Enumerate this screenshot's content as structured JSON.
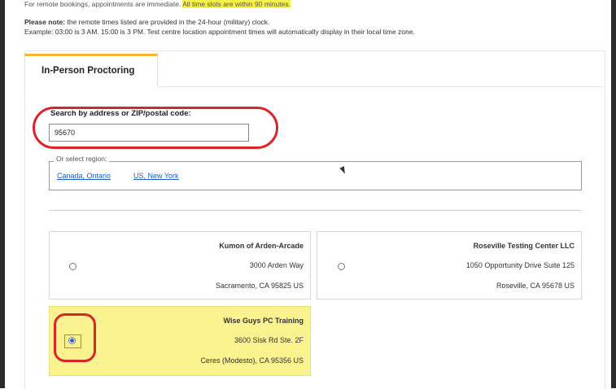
{
  "notes": {
    "top_prefix": "For remote bookings, appointments are immediate.",
    "top_highlight": "All time slots are within 90 minutes.",
    "please_note_bold": "Please note:",
    "please_note_text": "the remote times listed are provided in the 24-hour (military) clock.",
    "example": "Example: 03:00 is 3 AM.  15:00 is 3 PM. Test centre location appointment times will automatically display in their local time zone."
  },
  "tab": {
    "label": "In-Person Proctoring"
  },
  "search": {
    "label": "Search by address or ZIP/postal code:",
    "value": "95670"
  },
  "region": {
    "legend": "Or select region:",
    "links": [
      "Canada, Ontario",
      "US, New York"
    ]
  },
  "locations": [
    {
      "name": "Kumon of Arden-Arcade",
      "address": "3000 Arden Way",
      "city": "Sacramento, CA 95825 US",
      "selected": false
    },
    {
      "name": "Roseville Testing Center LLC",
      "address": "1050 Opportunity Drive Suite 125",
      "city": "Roseville, CA 95678 US",
      "selected": false
    },
    {
      "name": "Wise Guys PC Training",
      "address": "3600 Sisk Rd Ste. 2F",
      "city": "Ceres (Modesto), CA 95356 US",
      "selected": true
    }
  ],
  "colors": {
    "accent_tab": "#f1b82d",
    "selected_card": "#faf28e",
    "annotation_red": "#d9242b",
    "link": "#1a5cc2"
  }
}
